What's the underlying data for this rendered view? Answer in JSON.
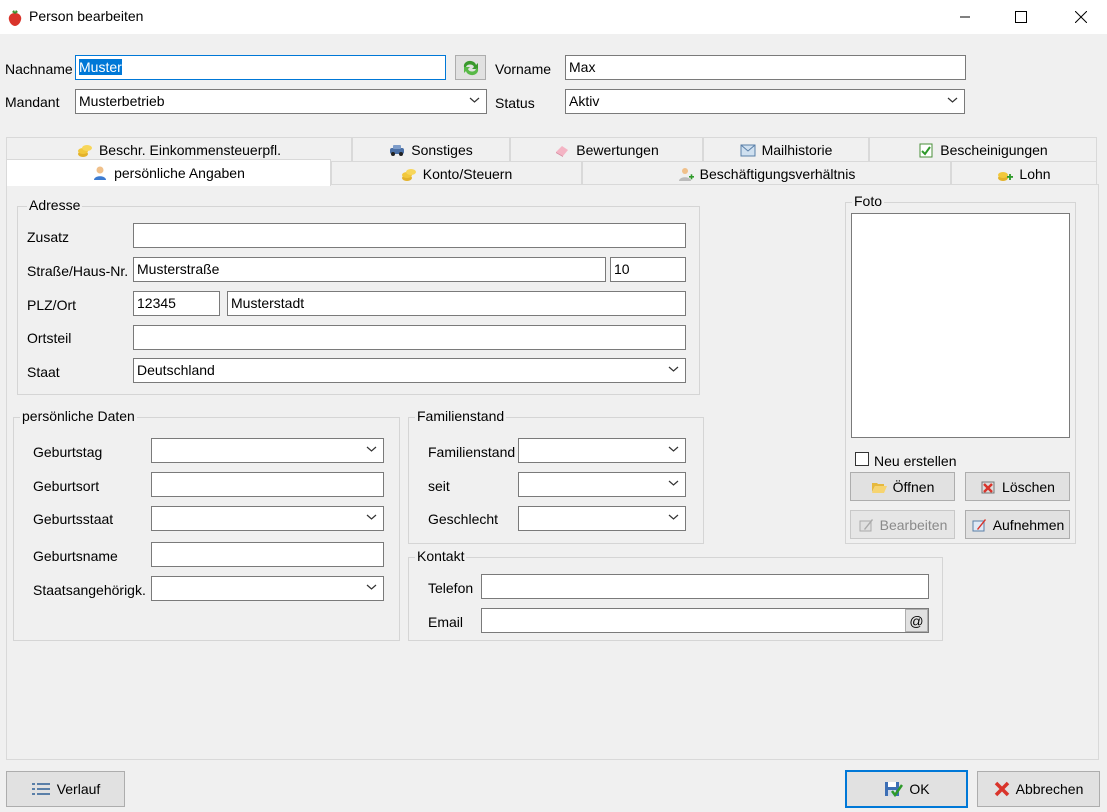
{
  "window": {
    "title": "Person bearbeiten"
  },
  "header": {
    "nachname_label": "Nachname",
    "nachname_value": "Muster",
    "vorname_label": "Vorname",
    "vorname_value": "Max",
    "mandant_label": "Mandant",
    "mandant_value": "Musterbetrieb",
    "status_label": "Status",
    "status_value": "Aktiv"
  },
  "tabs": {
    "row1": [
      "Beschr. Einkommensteuerpfl.",
      "Sonstiges",
      "Bewertungen",
      "Mailhistorie",
      "Bescheinigungen"
    ],
    "row2": [
      "persönliche Angaben",
      "Konto/Steuern",
      "Beschäftigungsverhältnis",
      "Lohn"
    ]
  },
  "adresse": {
    "title": "Adresse",
    "zusatz_label": "Zusatz",
    "zusatz_value": "",
    "strasse_label": "Straße/Haus-Nr.",
    "strasse_value": "Musterstraße",
    "hausnr_value": "10",
    "plzort_label": "PLZ/Ort",
    "plz_value": "12345",
    "ort_value": "Musterstadt",
    "ortsteil_label": "Ortsteil",
    "ortsteil_value": "",
    "staat_label": "Staat",
    "staat_value": "Deutschland"
  },
  "persoenlich": {
    "title": "persönliche Daten",
    "geburtstag_label": "Geburtstag",
    "geburtsort_label": "Geburtsort",
    "geburtsstaat_label": "Geburtsstaat",
    "geburtsname_label": "Geburtsname",
    "staatsang_label": "Staatsangehörigk."
  },
  "familienstand": {
    "title": "Familienstand",
    "familienstand_label": "Familienstand",
    "seit_label": "seit",
    "geschlecht_label": "Geschlecht"
  },
  "kontakt": {
    "title": "Kontakt",
    "telefon_label": "Telefon",
    "email_label": "Email",
    "at_button": "@"
  },
  "foto": {
    "title": "Foto",
    "neu_erstellen": "Neu erstellen",
    "oeffnen": "Öffnen",
    "loeschen": "Löschen",
    "bearbeiten": "Bearbeiten",
    "aufnehmen": "Aufnehmen"
  },
  "footer": {
    "verlauf": "Verlauf",
    "ok": "OK",
    "abbrechen": "Abbrechen"
  },
  "colors": {
    "accent": "#0078d7",
    "selection": "#0078d7"
  }
}
